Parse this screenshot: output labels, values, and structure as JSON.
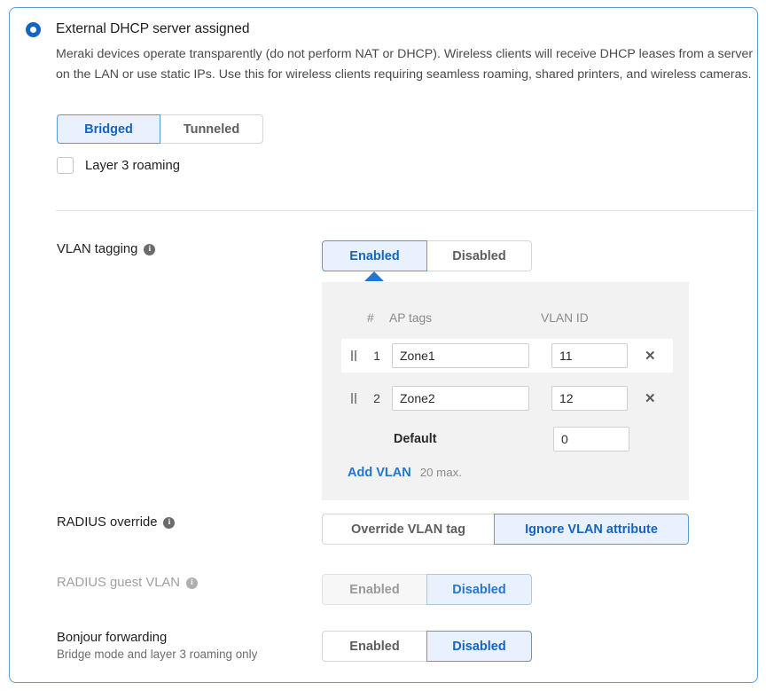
{
  "mode_option": {
    "title": "External DHCP server assigned",
    "description": "Meraki devices operate transparently (do not perform NAT or DHCP). Wireless clients will receive DHCP leases from a server on the LAN or use static IPs. Use this for wireless clients requiring seamless roaming, shared printers, and wireless cameras.",
    "segments": [
      {
        "label": "Bridged",
        "selected": true
      },
      {
        "label": "Tunneled",
        "selected": false
      }
    ],
    "layer3_roaming": {
      "label": "Layer 3 roaming",
      "checked": false
    }
  },
  "vlan_tagging": {
    "label": "VLAN tagging",
    "info_icon": "info-icon",
    "segments": [
      {
        "label": "Enabled",
        "selected": true
      },
      {
        "label": "Disabled",
        "selected": false
      }
    ],
    "table": {
      "columns": [
        "#",
        "AP tags",
        "VLAN ID"
      ],
      "rows": [
        {
          "num": "1",
          "ap_tag": "Zone1",
          "vlan_id": "11",
          "delete_icon": "close-icon",
          "drag_icon": "drag-handle-icon"
        },
        {
          "num": "2",
          "ap_tag": "Zone2",
          "vlan_id": "12",
          "delete_icon": "close-icon",
          "drag_icon": "drag-handle-icon"
        }
      ],
      "default_row": {
        "label": "Default",
        "vlan_id": "0"
      },
      "add_link": "Add VLAN",
      "add_note": "20 max."
    }
  },
  "radius_override": {
    "label": "RADIUS override",
    "info_icon": "info-icon",
    "segments": [
      {
        "label": "Override VLAN tag",
        "selected": false
      },
      {
        "label": "Ignore VLAN attribute",
        "selected": true
      }
    ]
  },
  "radius_guest_vlan": {
    "label": "RADIUS guest VLAN",
    "info_icon": "info-icon",
    "disabled": true,
    "segments": [
      {
        "label": "Enabled",
        "selected": false
      },
      {
        "label": "Disabled",
        "selected": true
      }
    ]
  },
  "bonjour_forwarding": {
    "label": "Bonjour forwarding",
    "sublabel": "Bridge mode and layer 3 roaming only",
    "segments": [
      {
        "label": "Enabled",
        "selected": false
      },
      {
        "label": "Disabled",
        "selected": true
      }
    ]
  },
  "colors": {
    "accent": "#2176d2",
    "selected_fill": "#e8f1fd",
    "selected_border": "#5b9bd5",
    "panel_border": "#5b9bd5",
    "table_bg": "#f2f2f2"
  }
}
